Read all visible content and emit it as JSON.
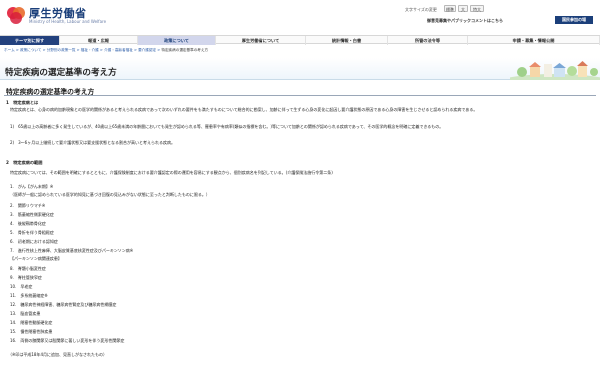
{
  "header": {
    "logo_title": "厚生労働省",
    "logo_sub": "Ministry of Health, Labour and Welfare",
    "font_size_label": "文字サイズの変更",
    "font_sizes": [
      "標準",
      "大",
      "特大"
    ],
    "search_button": "検索",
    "link_opinions": "御意見募集やパブリックコメントはこちら",
    "access_button": "国民参加の場"
  },
  "nav": {
    "items": [
      "テーマ別に探す",
      "報道・広報",
      "政策について",
      "厚生労働省について",
      "統計情報・白書",
      "所管の法令等",
      "申請・募集・情報公開"
    ],
    "active_index": 2
  },
  "breadcrumb": [
    "ホーム",
    "政策について",
    "分野別の政策一覧",
    "福祉・介護",
    "介護・高齢者福祉",
    "要介護認定"
  ],
  "breadcrumb_current": "特定疾病の選定基準の考え方",
  "page_title": "特定疾病の選定基準の考え方",
  "section_title": "特定疾病の選定基準の考え方",
  "s1": {
    "heading": "1　特定疾病とは",
    "intro": "特定疾病とは、心身の病的加齢現象との医学的関係があると考えられる疾病であって次のいずれの要件をも満たすものについて総合的に勘案し、加齢に伴って生ずる心身の変化に起因し要介護状態の原因である心身の障害を生じさせると認められる疾病である。",
    "item1": "1)　65歳以上の高齢者に多く発生しているが、40歳以上65歳未満の年齢層においても発生が認められる等、罹患率や有病率(類似の指標を含む。)等について加齢との関係が認められる疾病であって、その医学的概念を明確に定義できるもの。",
    "item2": "2)　3～6ヶ月以上継続して要介護状態又は要支援状態となる割合が高いと考えられる疾病。"
  },
  "s2": {
    "heading": "2　特定疾病の範囲",
    "intro": "特定疾病については、その範囲を明確にするとともに、介護保険制度における要介護認定の際の運用を容易にする観点から、個別疾病名を列記している。(介護保険法施行令第二条)",
    "diseases": [
      "1.　がん【がん末期】※",
      "（医師が一般に認められている医学的知見に基づき回復の見込みがない状態に至ったと判断したものに限る。）",
      "2.　関節リウマチ※",
      "3.　筋萎縮性側索硬化症",
      "4.　後縦靱帯骨化症",
      "5.　骨折を伴う骨粗鬆症",
      "6.　初老期における認知症",
      "7.　進行性核上性麻痺、大脳皮質基底核変性症及びパーキンソン病※",
      "【パーキンソン病関連疾患】",
      "8.　脊髄小脳変性症",
      "9.　脊柱管狭窄症",
      "10.　早老症",
      "11.　多系統萎縮症※",
      "12.　糖尿病性神経障害、糖尿病性腎症及び糖尿病性網膜症",
      "13.　脳血管疾患",
      "14.　閉塞性動脈硬化症",
      "15.　慢性閉塞性肺疾患",
      "16.　両側の膝関節又は股関節に著しい変形を伴う変形性関節症"
    ],
    "note": "（※印は平成18年4月に追加、見直しがなされたもの）"
  }
}
